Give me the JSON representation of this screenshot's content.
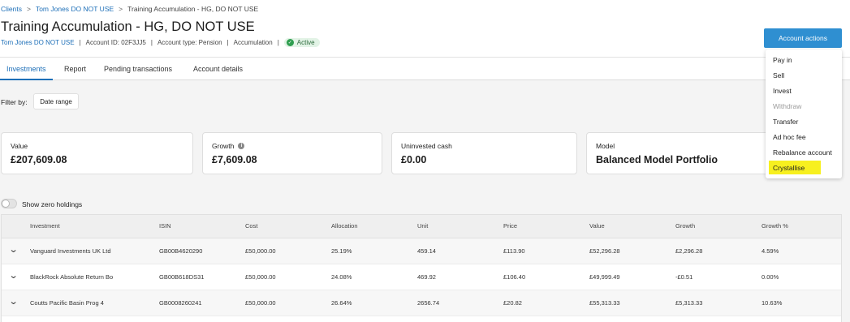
{
  "breadcrumb": {
    "root": "Clients",
    "client": "Tom Jones DO NOT USE",
    "current": "Training Accumulation - HG, DO NOT USE",
    "separator": ">"
  },
  "page_title": "Training Accumulation - HG, DO NOT USE",
  "meta": {
    "client_link": "Tom Jones DO NOT USE",
    "account_id": "Account ID: 02F3JJ5",
    "account_type": "Account type: Pension",
    "accumulation": "Accumulation",
    "status": "Active",
    "separator": "|"
  },
  "actions_button": "Account actions",
  "actions_menu": [
    {
      "label": "Pay in",
      "enabled": true
    },
    {
      "label": "Sell",
      "enabled": true
    },
    {
      "label": "Invest",
      "enabled": true
    },
    {
      "label": "Withdraw",
      "enabled": false
    },
    {
      "label": "Transfer",
      "enabled": true
    },
    {
      "label": "Ad hoc fee",
      "enabled": true
    },
    {
      "label": "Rebalance account",
      "enabled": true
    },
    {
      "label": "Crystallise",
      "enabled": true,
      "highlighted": true,
      "highlight_color": "#f7f01f"
    }
  ],
  "tabs": [
    {
      "label": "Investments",
      "active": true
    },
    {
      "label": "Report",
      "active": false
    },
    {
      "label": "Pending transactions",
      "active": false
    },
    {
      "label": "Account details",
      "active": false
    }
  ],
  "filter": {
    "label": "Filter by:",
    "button": "Date range"
  },
  "cards": [
    {
      "label": "Value",
      "value": "£207,609.08"
    },
    {
      "label": "Growth",
      "value": "£7,609.08",
      "icon": "info-icon"
    },
    {
      "label": "Uninvested cash",
      "value": "£0.00"
    },
    {
      "label": "Model",
      "value": "Balanced Model Portfolio"
    }
  ],
  "zero_holdings": {
    "label": "Show zero holdings",
    "enabled": false
  },
  "table": {
    "columns": [
      "Investment",
      "ISIN",
      "Cost",
      "Allocation",
      "Unit",
      "Price",
      "Value",
      "Growth",
      "Growth %"
    ],
    "rows": [
      [
        "Vanguard Investments UK Ltd",
        "GB00B4620290",
        "£50,000.00",
        "25.19%",
        "459.14",
        "£113.90",
        "£52,296.28",
        "£2,296.28",
        "4.59%"
      ],
      [
        "BlackRock Absolute Return Bo",
        "GB00B618DS31",
        "£50,000.00",
        "24.08%",
        "469.92",
        "£106.40",
        "£49,999.49",
        "-£0.51",
        "0.00%"
      ],
      [
        "Coutts Pacific Basin Prog 4",
        "GB0008260241",
        "£50,000.00",
        "26.64%",
        "2656.74",
        "£20.82",
        "£55,313.33",
        "£5,313.33",
        "10.63%"
      ]
    ]
  },
  "colors": {
    "accent": "#1d6fb8",
    "button": "#2f8fd1",
    "active_badge": "#2e9e4f"
  }
}
